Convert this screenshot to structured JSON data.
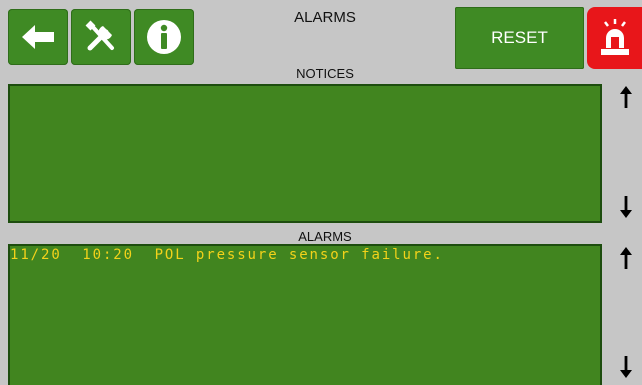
{
  "header": {
    "title": "ALARMS",
    "reset_label": "RESET",
    "buttons": {
      "back_icon": "arrow-left-icon",
      "tools_icon": "wrench-screwdriver-icon",
      "info_icon": "info-icon",
      "alarm_icon": "alarm-beacon-icon"
    }
  },
  "notices": {
    "heading": "NOTICES",
    "entries": []
  },
  "alarms": {
    "heading": "ALARMS",
    "entries": [
      "11/20  10:20  POL pressure sensor failure."
    ]
  },
  "colors": {
    "background": "#c6c6c6",
    "button_green": "#3f8a24",
    "panel_green": "#41851f",
    "alarm_text": "#f3d21a",
    "alarm_red": "#e8161a"
  }
}
